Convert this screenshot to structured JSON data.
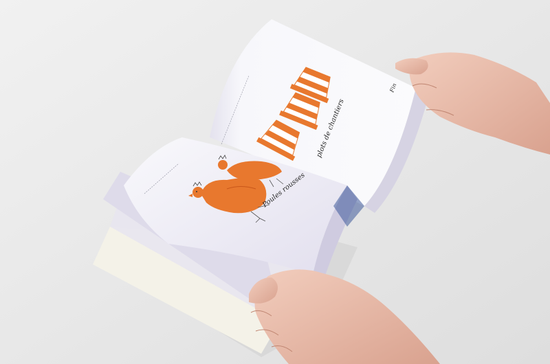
{
  "photo": {
    "subject": "",
    "background_color": "#e9e9e9",
    "accent_color": "#e8782e"
  },
  "book": {
    "right_page": {
      "caption": "plots de chantiers",
      "page_number": "Fin"
    },
    "left_page": {
      "caption": "Poules rousses"
    }
  }
}
